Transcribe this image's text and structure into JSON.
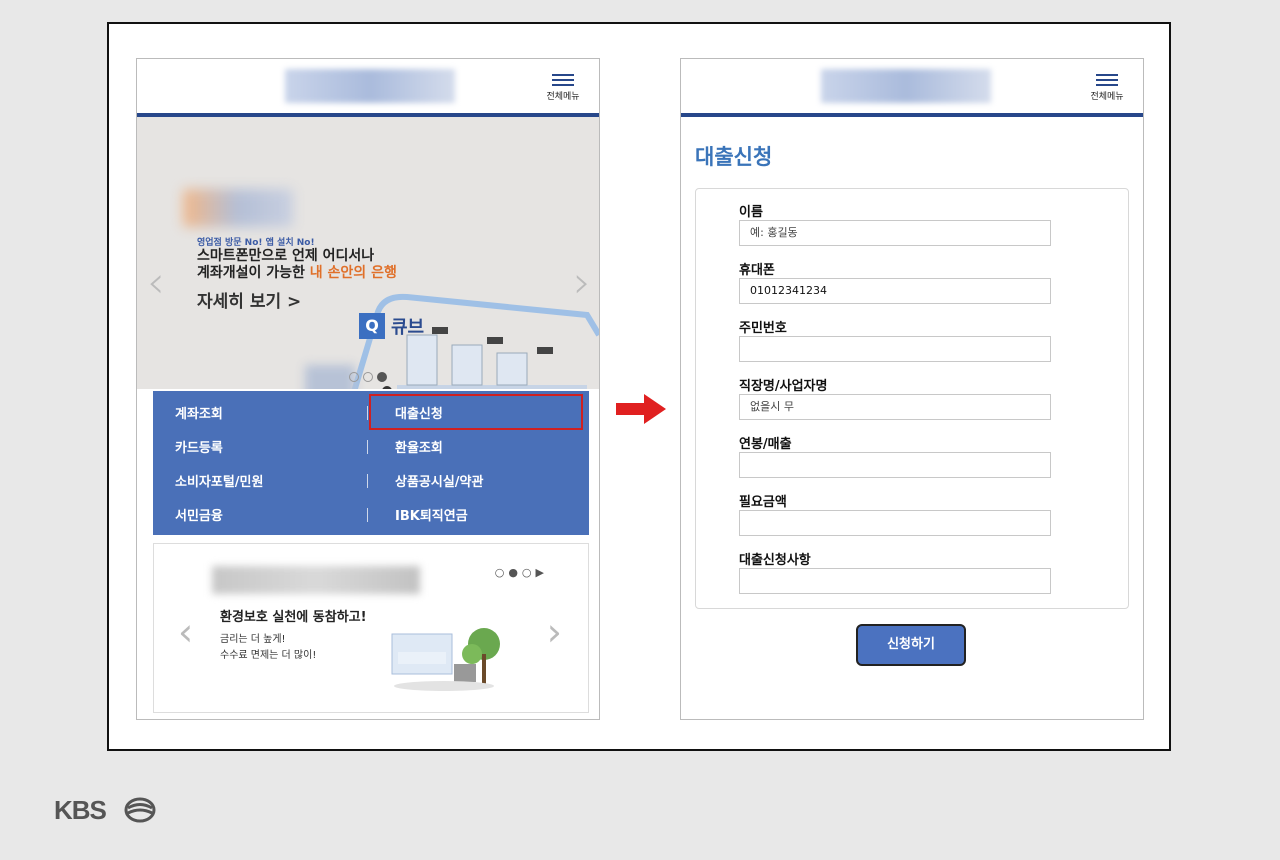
{
  "left_phone": {
    "menu_label": "전체메뉴",
    "banner": {
      "sub": "영업점 방문 No! 앱 설치 No!",
      "line1": "스마트폰만으로 언제 어디서나",
      "line2_prefix": "계좌개설이 가능한 ",
      "line2_highlight": "내 손안의 은행",
      "more": "자세히 보기  >",
      "brand_letter": "Q",
      "brand_name": "큐브"
    },
    "quick_menu": [
      {
        "label": "계좌조회"
      },
      {
        "label": "대출신청"
      },
      {
        "label": "카드등록"
      },
      {
        "label": "환율조회"
      },
      {
        "label": "소비자포털/민원"
      },
      {
        "label": "상품공시실/약관"
      },
      {
        "label": "서민금융"
      },
      {
        "label": "IBK퇴직연금"
      }
    ],
    "promo": {
      "title": "환경보호 실천에 동참하고!",
      "line1": "금리는 더 높게!",
      "line2": "수수료 면제는 더 많이!"
    }
  },
  "right_phone": {
    "menu_label": "전체메뉴",
    "page_title": "대출신청",
    "fields": [
      {
        "label": "이름",
        "value": "",
        "placeholder": "예: 홍길동"
      },
      {
        "label": "휴대폰",
        "value": "01012341234",
        "placeholder": ""
      },
      {
        "label": "주민번호",
        "value": "",
        "placeholder": ""
      },
      {
        "label": "직장명/사업자명",
        "value": "",
        "placeholder": "없을시 무"
      },
      {
        "label": "연봉/매출",
        "value": "",
        "placeholder": ""
      },
      {
        "label": "필요금액",
        "value": "",
        "placeholder": ""
      },
      {
        "label": "대출신청사항",
        "value": "",
        "placeholder": ""
      }
    ],
    "submit_label": "신청하기"
  },
  "watermark": "KBS",
  "colors": {
    "brand_blue": "#27478a",
    "menu_blue": "#4a70b8",
    "title_blue": "#3a74b9",
    "highlight_red": "#d02020",
    "accent_orange": "#e0702a"
  }
}
